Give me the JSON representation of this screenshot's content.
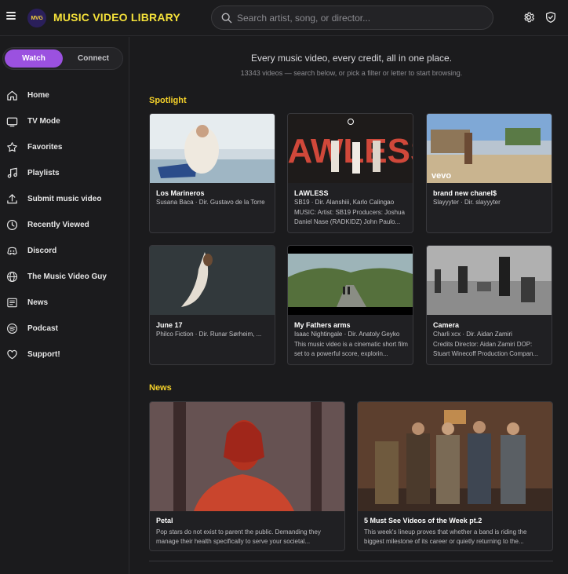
{
  "header": {
    "logo_text": "MVG",
    "brand": "MUSIC VIDEO LIBRARY",
    "search_placeholder": "Search artist, song, or director..."
  },
  "toggle": {
    "active": "Watch",
    "inactive": "Connect"
  },
  "nav": [
    {
      "label": "Home",
      "icon": "home-icon"
    },
    {
      "label": "TV Mode",
      "icon": "tv-icon"
    },
    {
      "label": "Favorites",
      "icon": "star-icon"
    },
    {
      "label": "Playlists",
      "icon": "music-note-icon"
    },
    {
      "label": "Submit music video",
      "icon": "upload-icon"
    },
    {
      "label": "Recently Viewed",
      "icon": "clock-icon"
    },
    {
      "label": "Discord",
      "icon": "discord-icon"
    },
    {
      "label": "The Music Video Guy",
      "icon": "globe-icon"
    },
    {
      "label": "News",
      "icon": "newspaper-icon"
    },
    {
      "label": "Podcast",
      "icon": "spotify-icon"
    },
    {
      "label": "Support!",
      "icon": "heart-icon"
    }
  ],
  "main": {
    "tagline": "Every music video, every credit, all in one place.",
    "subline": "13343 videos — search below, or pick a filter or letter to start browsing.",
    "spotlight_title": "Spotlight",
    "news_title": "News"
  },
  "spotlight": [
    {
      "title": "Los Marineros",
      "subtitle": "Susana Baca · Dir. Gustavo de la Torre",
      "desc": ""
    },
    {
      "title": "LAWLESS",
      "subtitle": "SB19 · Dir. Alanshiii, Karlo Calingao",
      "desc": "MUSIC: Artist: SB19 Producers: Joshua Daniel Nase (RADKIDZ) John Paulo..."
    },
    {
      "title": "brand new chanel$",
      "subtitle": "Slayyyter · Dir. slayyyter",
      "desc": ""
    },
    {
      "title": "June 17",
      "subtitle": "Philco Fiction · Dir. Runar Sørheim, ...",
      "desc": ""
    },
    {
      "title": "My Fathers arms",
      "subtitle": "Isaac Nightingale · Dir. Anatoly Geyko",
      "desc": "This music video is a cinematic short film set to a powerful score, explorin..."
    },
    {
      "title": "Camera",
      "subtitle": "Charli xcx · Dir. Aidan Zamiri",
      "desc": "Credits Director: Aidan Zamiri DOP: Stuart Winecoff Production Compan..."
    }
  ],
  "news": [
    {
      "title": "Petal",
      "desc": "Pop stars do not exist to parent the public. Demanding they manage their health specifically to serve your societal..."
    },
    {
      "title": "5 Must See Videos of the Week pt.2",
      "desc": "This week's lineup proves that whether a band is riding the biggest milestone of its career or quietly returning to the..."
    }
  ],
  "thumb_overlays": {
    "lawless_text": "LAWLESS",
    "vevo": "vevo"
  },
  "colors": {
    "accent_yellow": "#f4d12a",
    "toggle_purple": "#9b51e0",
    "background": "#1b1b1d"
  }
}
